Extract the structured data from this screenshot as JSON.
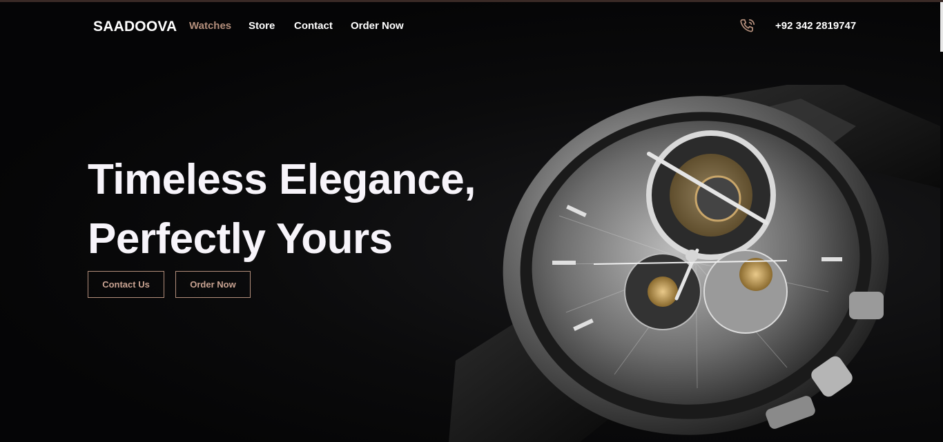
{
  "nav": {
    "brand": "SAADOOVA",
    "links": [
      {
        "label": "Watches",
        "active": true
      },
      {
        "label": "Store",
        "active": false
      },
      {
        "label": "Contact",
        "active": false
      },
      {
        "label": "Order Now",
        "active": false
      }
    ],
    "phone_icon": "phone-icon",
    "phone_number": "+92 342 2819747"
  },
  "hero": {
    "headline_line1": "Timeless Elegance,",
    "headline_line2": "Perfectly Yours",
    "contact_button": "Contact Us",
    "order_button": "Order Now",
    "image": "luxury-skeleton-chronograph-watch"
  },
  "colors": {
    "background": "#050506",
    "accent": "#b48f7c",
    "headline": "#f7f4fa"
  }
}
